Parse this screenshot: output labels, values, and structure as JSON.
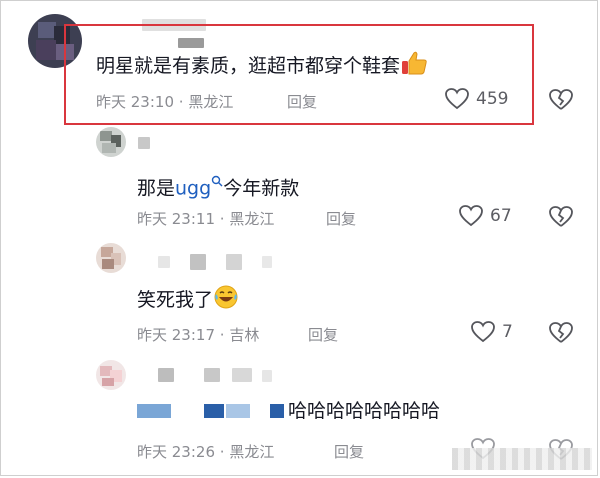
{
  "comments": [
    {
      "content": "明星就是有素质，逛超市都穿个鞋套",
      "date": "昨天 23:10",
      "location": "黑龙江",
      "reply_label": "回复",
      "likes": "459",
      "emoji_icon": "thumbs-up-icon"
    },
    {
      "content_prefix": "那是",
      "content_link": "ugg",
      "content_suffix": "今年新款",
      "date": "昨天 23:11",
      "location": "黑龙江",
      "reply_label": "回复",
      "likes": "67",
      "link_icon": "search-icon"
    },
    {
      "content": "笑死我了",
      "date": "昨天 23:17",
      "location": "吉林",
      "reply_label": "回复",
      "likes": "7",
      "emoji_icon": "laughing-tears-icon"
    },
    {
      "content": "哈哈哈哈哈哈哈哈",
      "date": "昨天 23:26",
      "location": "黑龙江",
      "reply_label": "回复"
    }
  ],
  "separator": "·",
  "colors": {
    "highlight_border": "#d9363e",
    "meta_text": "#8a8b91",
    "link_text": "#1f5fbf"
  }
}
